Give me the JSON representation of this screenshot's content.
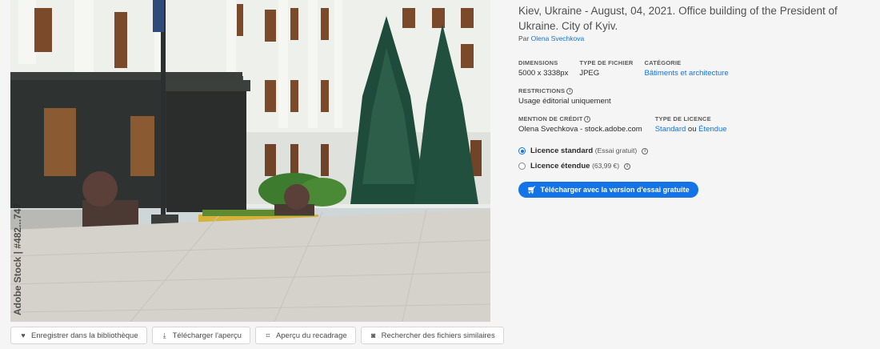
{
  "image": {
    "watermark": "Adobe Stock | #482...747",
    "alt": "Office building of the President of Ukraine"
  },
  "actions": [
    {
      "label": "Enregistrer dans la bibliothèque",
      "icon": "heart-icon"
    },
    {
      "label": "Télécharger l'aperçu",
      "icon": "download-icon"
    },
    {
      "label": "Aperçu du recadrage",
      "icon": "crop-icon"
    },
    {
      "label": "Rechercher des fichiers similaires",
      "icon": "camera-search-icon"
    }
  ],
  "details": {
    "title": "Kiev, Ukraine - August, 04, 2021. Office building of the President of Ukraine. City of Kyiv.",
    "author_prefix": "Par",
    "author": "Olena Svechkova",
    "dimensions_label": "DIMENSIONS",
    "dimensions_value": "5000 x 3338px",
    "filetype_label": "TYPE DE FICHIER",
    "filetype_value": "JPEG",
    "category_label": "CATÉGORIE",
    "category_value": "Bâtiments et architecture",
    "restrictions_label": "RESTRICTIONS",
    "restrictions_value": "Usage éditorial uniquement",
    "credit_label": "MENTION DE CRÉDIT",
    "credit_value": "Olena Svechkova - stock.adobe.com",
    "license_type_label": "TYPE DE LICENCE",
    "license_standard": "Standard",
    "license_or": "ou",
    "license_extended": "Étendue"
  },
  "licenses": [
    {
      "name": "Licence standard",
      "note": "(Essai gratuit)",
      "checked": true
    },
    {
      "name": "Licence étendue",
      "note": "(63,99 €)",
      "checked": false
    }
  ],
  "cta": {
    "label": "Télécharger avec la version d'essai gratuite",
    "icon": "cart-icon"
  },
  "colors": {
    "accent": "#1473e6",
    "background": "#f5f5f5"
  }
}
